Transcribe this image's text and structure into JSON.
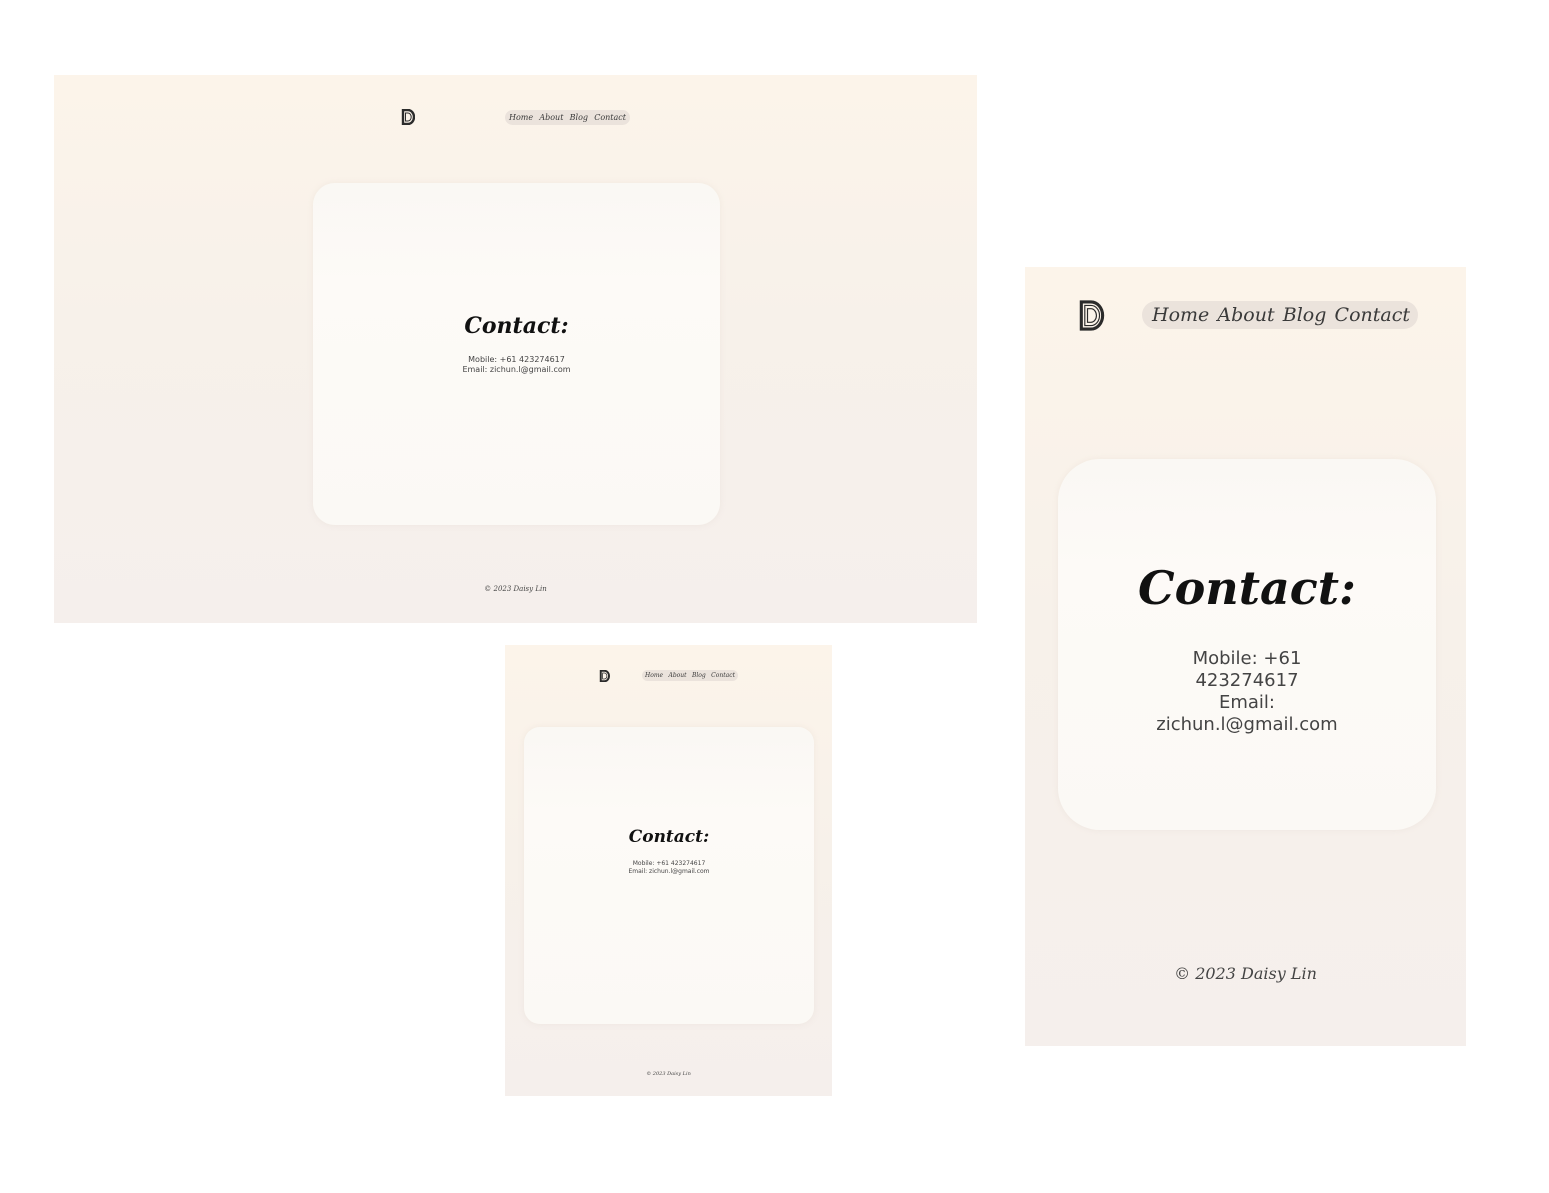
{
  "brand": {
    "logo_letter": "D"
  },
  "nav": {
    "items": [
      {
        "label": "Home"
      },
      {
        "label": "About"
      },
      {
        "label": "Blog"
      },
      {
        "label": "Contact"
      }
    ]
  },
  "contact": {
    "heading": "Contact:",
    "mobile_line": "Mobile: +61 423274617",
    "email_line": "Email: zichun.l@gmail.com",
    "mobile_label": "Mobile: +61",
    "mobile_number": "423274617",
    "email_label": "Email:",
    "email_value": "zichun.l@gmail.com"
  },
  "footer": {
    "text": "© 2023 Daisy Lin"
  },
  "colors": {
    "background": "#f7f1ea",
    "card": "#fbf9f5",
    "nav_pill": "#ebe3dc",
    "text": "#222222"
  }
}
